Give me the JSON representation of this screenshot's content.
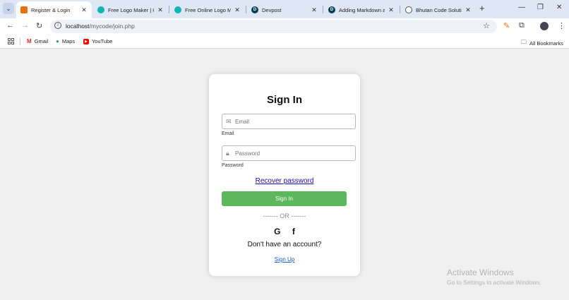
{
  "browser": {
    "tabs": [
      {
        "title": "Register & Login",
        "favicon": "login-favicon",
        "color": "#e8710a"
      },
      {
        "title": "Free Logo Maker | Cre",
        "favicon": "logo-maker-favicon",
        "color": "#12b5b5"
      },
      {
        "title": "Free Online Logo Ma",
        "favicon": "logo-maker-favicon",
        "color": "#12b5b5"
      },
      {
        "title": "Devpost",
        "favicon": "devpost-favicon",
        "color": "#003e54"
      },
      {
        "title": "Adding Markdown an",
        "favicon": "devpost-favicon",
        "color": "#003e54"
      },
      {
        "title": "Bhutan Code Solution",
        "favicon": "globe-icon",
        "color": "#555555"
      }
    ],
    "url_host": "localhost",
    "url_path": "/mycode/join.php",
    "bookmarks": [
      {
        "label": "Gmail",
        "icon": "gmail-icon"
      },
      {
        "label": "Maps",
        "icon": "maps-icon"
      },
      {
        "label": "YouTube",
        "icon": "youtube-icon"
      }
    ],
    "all_bookmarks": "All Bookmarks"
  },
  "form": {
    "title": "Sign In",
    "email_placeholder": "Email",
    "email_label": "Email",
    "password_placeholder": "Password",
    "password_label": "Password",
    "recover": "Recover password",
    "submit": "Sign In",
    "or": "------- OR -------",
    "google": "G",
    "facebook": "f",
    "no_account": "Don't have an account?",
    "signup": "Sign Up"
  },
  "watermark": {
    "line1": "Activate Windows",
    "line2": "Go to Settings to activate Windows."
  },
  "colors": {
    "accent": "#5cb85c",
    "link": "#1a0dab"
  }
}
